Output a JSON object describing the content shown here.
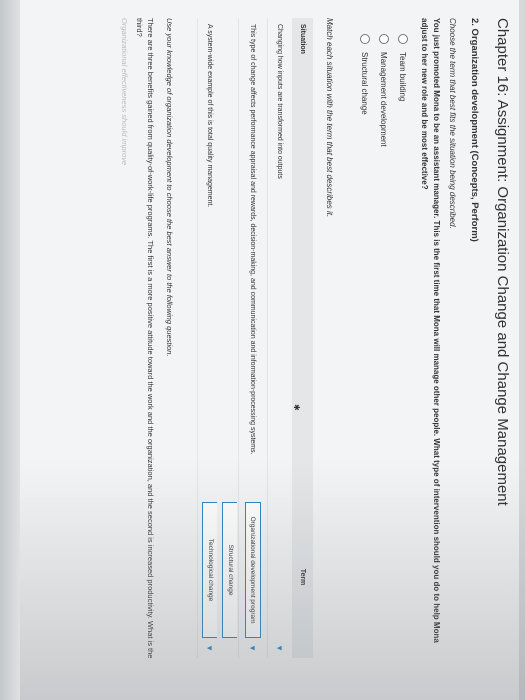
{
  "page": {
    "title": "Chapter 16: Assignment: Organization Change and Change Management"
  },
  "section": {
    "heading": "2. Organization development (Concepts, Perform)"
  },
  "part1": {
    "instruction": "Choose the term that best fits the situation being described.",
    "question": "You just promoted Mona to be an assistant manager. This is the first time that Mona will manage other people. What type of intervention should you do to help Mona adjust to her new role and be most effective?",
    "options": [
      "Team building",
      "Management development",
      "Structural change"
    ]
  },
  "part2": {
    "instruction": "Match each situation with the term that best describes it.",
    "headers": {
      "situation": "Situation",
      "term": "Term"
    },
    "rows": [
      {
        "situation": "Changing how inputs are transformed into outputs",
        "term": ""
      },
      {
        "situation": "This type of change affects performance appraisal and rewards, decision-making, and communication and information-processing systems.",
        "term": "Organizational development program"
      },
      {
        "situation": "",
        "term": "Structural change"
      },
      {
        "situation": "A system-wide example of this is total quality management.",
        "term": "Technological change"
      }
    ]
  },
  "part3": {
    "instruction": "Use your knowledge of organization development to choose the best answer to the following question.",
    "text": "There are three benefits gained from quality-of-work-life programs. The first is a more positive attitude toward the work and the organization, and the second is increased productivity. What is the third?",
    "faded": "Organizational effectiveness should improve"
  },
  "colors": {
    "accent": "#2a84c4",
    "background": "#f3f4f5"
  },
  "icons": {
    "dropdown": "caret-down-icon",
    "cursor": "mouse-cursor-icon"
  }
}
